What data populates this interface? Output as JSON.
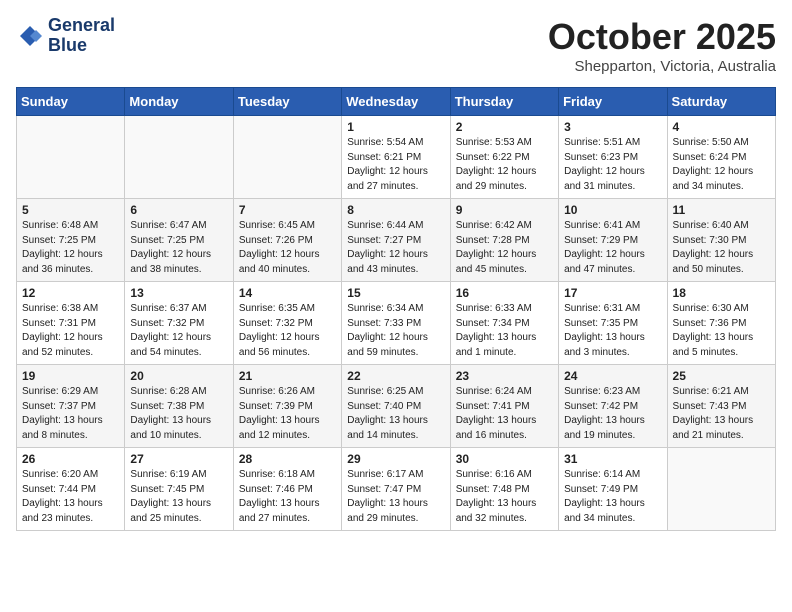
{
  "logo": {
    "line1": "General",
    "line2": "Blue"
  },
  "title": "October 2025",
  "location": "Shepparton, Victoria, Australia",
  "header_days": [
    "Sunday",
    "Monday",
    "Tuesday",
    "Wednesday",
    "Thursday",
    "Friday",
    "Saturday"
  ],
  "weeks": [
    [
      {
        "day": "",
        "info": ""
      },
      {
        "day": "",
        "info": ""
      },
      {
        "day": "",
        "info": ""
      },
      {
        "day": "1",
        "info": "Sunrise: 5:54 AM\nSunset: 6:21 PM\nDaylight: 12 hours\nand 27 minutes."
      },
      {
        "day": "2",
        "info": "Sunrise: 5:53 AM\nSunset: 6:22 PM\nDaylight: 12 hours\nand 29 minutes."
      },
      {
        "day": "3",
        "info": "Sunrise: 5:51 AM\nSunset: 6:23 PM\nDaylight: 12 hours\nand 31 minutes."
      },
      {
        "day": "4",
        "info": "Sunrise: 5:50 AM\nSunset: 6:24 PM\nDaylight: 12 hours\nand 34 minutes."
      }
    ],
    [
      {
        "day": "5",
        "info": "Sunrise: 6:48 AM\nSunset: 7:25 PM\nDaylight: 12 hours\nand 36 minutes."
      },
      {
        "day": "6",
        "info": "Sunrise: 6:47 AM\nSunset: 7:25 PM\nDaylight: 12 hours\nand 38 minutes."
      },
      {
        "day": "7",
        "info": "Sunrise: 6:45 AM\nSunset: 7:26 PM\nDaylight: 12 hours\nand 40 minutes."
      },
      {
        "day": "8",
        "info": "Sunrise: 6:44 AM\nSunset: 7:27 PM\nDaylight: 12 hours\nand 43 minutes."
      },
      {
        "day": "9",
        "info": "Sunrise: 6:42 AM\nSunset: 7:28 PM\nDaylight: 12 hours\nand 45 minutes."
      },
      {
        "day": "10",
        "info": "Sunrise: 6:41 AM\nSunset: 7:29 PM\nDaylight: 12 hours\nand 47 minutes."
      },
      {
        "day": "11",
        "info": "Sunrise: 6:40 AM\nSunset: 7:30 PM\nDaylight: 12 hours\nand 50 minutes."
      }
    ],
    [
      {
        "day": "12",
        "info": "Sunrise: 6:38 AM\nSunset: 7:31 PM\nDaylight: 12 hours\nand 52 minutes."
      },
      {
        "day": "13",
        "info": "Sunrise: 6:37 AM\nSunset: 7:32 PM\nDaylight: 12 hours\nand 54 minutes."
      },
      {
        "day": "14",
        "info": "Sunrise: 6:35 AM\nSunset: 7:32 PM\nDaylight: 12 hours\nand 56 minutes."
      },
      {
        "day": "15",
        "info": "Sunrise: 6:34 AM\nSunset: 7:33 PM\nDaylight: 12 hours\nand 59 minutes."
      },
      {
        "day": "16",
        "info": "Sunrise: 6:33 AM\nSunset: 7:34 PM\nDaylight: 13 hours\nand 1 minute."
      },
      {
        "day": "17",
        "info": "Sunrise: 6:31 AM\nSunset: 7:35 PM\nDaylight: 13 hours\nand 3 minutes."
      },
      {
        "day": "18",
        "info": "Sunrise: 6:30 AM\nSunset: 7:36 PM\nDaylight: 13 hours\nand 5 minutes."
      }
    ],
    [
      {
        "day": "19",
        "info": "Sunrise: 6:29 AM\nSunset: 7:37 PM\nDaylight: 13 hours\nand 8 minutes."
      },
      {
        "day": "20",
        "info": "Sunrise: 6:28 AM\nSunset: 7:38 PM\nDaylight: 13 hours\nand 10 minutes."
      },
      {
        "day": "21",
        "info": "Sunrise: 6:26 AM\nSunset: 7:39 PM\nDaylight: 13 hours\nand 12 minutes."
      },
      {
        "day": "22",
        "info": "Sunrise: 6:25 AM\nSunset: 7:40 PM\nDaylight: 13 hours\nand 14 minutes."
      },
      {
        "day": "23",
        "info": "Sunrise: 6:24 AM\nSunset: 7:41 PM\nDaylight: 13 hours\nand 16 minutes."
      },
      {
        "day": "24",
        "info": "Sunrise: 6:23 AM\nSunset: 7:42 PM\nDaylight: 13 hours\nand 19 minutes."
      },
      {
        "day": "25",
        "info": "Sunrise: 6:21 AM\nSunset: 7:43 PM\nDaylight: 13 hours\nand 21 minutes."
      }
    ],
    [
      {
        "day": "26",
        "info": "Sunrise: 6:20 AM\nSunset: 7:44 PM\nDaylight: 13 hours\nand 23 minutes."
      },
      {
        "day": "27",
        "info": "Sunrise: 6:19 AM\nSunset: 7:45 PM\nDaylight: 13 hours\nand 25 minutes."
      },
      {
        "day": "28",
        "info": "Sunrise: 6:18 AM\nSunset: 7:46 PM\nDaylight: 13 hours\nand 27 minutes."
      },
      {
        "day": "29",
        "info": "Sunrise: 6:17 AM\nSunset: 7:47 PM\nDaylight: 13 hours\nand 29 minutes."
      },
      {
        "day": "30",
        "info": "Sunrise: 6:16 AM\nSunset: 7:48 PM\nDaylight: 13 hours\nand 32 minutes."
      },
      {
        "day": "31",
        "info": "Sunrise: 6:14 AM\nSunset: 7:49 PM\nDaylight: 13 hours\nand 34 minutes."
      },
      {
        "day": "",
        "info": ""
      }
    ]
  ]
}
